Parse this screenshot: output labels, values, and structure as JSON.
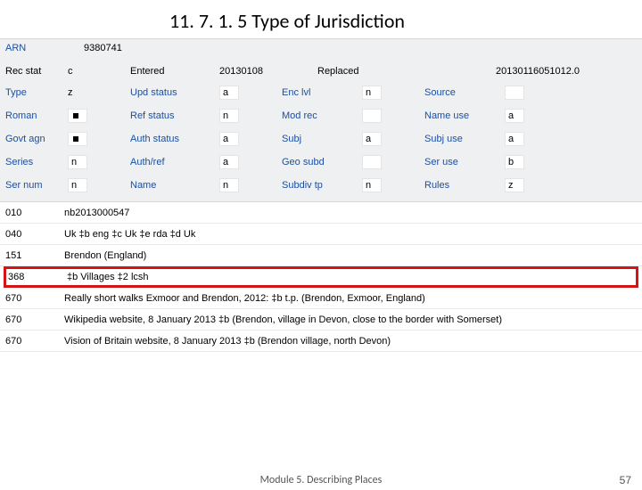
{
  "title": "11. 7. 1. 5   Type of Jurisdiction",
  "header": {
    "arn_label": "ARN",
    "arn_value": "9380741",
    "rec_stat_label": "Rec stat",
    "rec_stat_value": "c",
    "entered_label": "Entered",
    "entered_value": "20130108",
    "replaced_label": "Replaced",
    "replaced_value": "20130116051012.0"
  },
  "rows": [
    {
      "c1l": "Type",
      "c1v": "z",
      "c2l": "Upd status",
      "c2v": "a",
      "c3l": "Enc lvl",
      "c3v": "n",
      "c4l": "Source",
      "c4v": " "
    },
    {
      "c1l": "Roman",
      "c1v": "▪",
      "c2l": "Ref status",
      "c2v": "n",
      "c3l": "Mod rec",
      "c3v": " ",
      "c4l": "Name use",
      "c4v": "a"
    },
    {
      "c1l": "Govt agn",
      "c1v": "▪",
      "c2l": "Auth status",
      "c2v": "a",
      "c3l": "Subj",
      "c3v": "a",
      "c4l": "Subj use",
      "c4v": "a"
    },
    {
      "c1l": "Series",
      "c1v": "n",
      "c2l": "Auth/ref",
      "c2v": "a",
      "c3l": "Geo subd",
      "c3v": " ",
      "c4l": "Ser use",
      "c4v": "b"
    },
    {
      "c1l": "Ser num",
      "c1v": "n",
      "c2l": "Name",
      "c2v": "n",
      "c3l": "Subdiv tp",
      "c3v": "n",
      "c4l": "Rules",
      "c4v": "z"
    }
  ],
  "tags": [
    {
      "tag": "010",
      "content": "nb2013000547"
    },
    {
      "tag": "040",
      "content": "Uk ‡b eng ‡c Uk ‡e rda ‡d Uk"
    },
    {
      "tag": "151",
      "content": "Brendon (England)"
    },
    {
      "tag": "368",
      "content": "‡b Villages ‡2 lcsh",
      "highlight": true
    },
    {
      "tag": "670",
      "content": "Really short walks Exmoor and Brendon, 2012: ‡b t.p. (Brendon, Exmoor, England)"
    },
    {
      "tag": "670",
      "content": "Wikipedia website, 8 January 2013 ‡b (Brendon, village in Devon, close to the border with Somerset)"
    },
    {
      "tag": "670",
      "content": "Vision of Britain website, 8 January 2013 ‡b (Brendon village, north Devon)"
    }
  ],
  "footer": "Module 5. Describing Places",
  "page": "57"
}
